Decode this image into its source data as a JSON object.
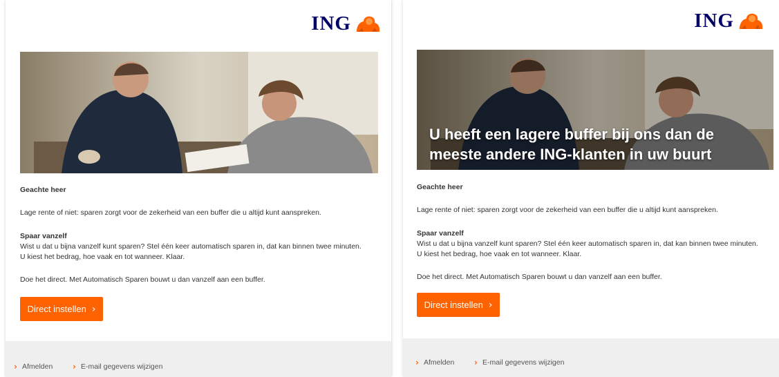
{
  "brand": {
    "name": "ING",
    "accent": "#ff6200",
    "navy": "#000066"
  },
  "emails": [
    {
      "logo_text": "ING",
      "hero_headline": "",
      "greeting": "Geachte heer",
      "intro": "Lage rente of niet: sparen zorgt voor de zekerheid van een buffer die u altijd kunt aanspreken.",
      "section_title": "Spaar vanzelf",
      "section_line1": "Wist u dat u bijna vanzelf kunt sparen? Stel één keer automatisch sparen in, dat kan binnen twee minuten.",
      "section_line2": "U kiest het bedrag, hoe vaak en tot wanneer. Klaar.",
      "closing": "Doe het direct. Met Automatisch Sparen bouwt u dan vanzelf aan een buffer.",
      "cta_label": "Direct instellen",
      "footer_links": [
        "Afmelden",
        "E-mail gegevens wijzigen"
      ]
    },
    {
      "logo_text": "ING",
      "hero_headline": "U heeft een lagere buffer bij ons dan de meeste andere ING-klanten in uw buurt",
      "greeting": "Geachte heer",
      "intro": "Lage rente of niet: sparen zorgt voor de zekerheid van een buffer die u altijd kunt aanspreken.",
      "section_title": "Spaar vanzelf",
      "section_line1": "Wist u dat u bijna vanzelf kunt sparen? Stel één keer automatisch sparen in, dat kan binnen twee minuten.",
      "section_line2": "U kiest het bedrag, hoe vaak en tot wanneer. Klaar.",
      "closing": "Doe het direct. Met Automatisch Sparen bouwt u dan vanzelf aan een buffer.",
      "cta_label": "Direct instellen",
      "footer_links": [
        "Afmelden",
        "E-mail gegevens wijzigen"
      ]
    }
  ]
}
